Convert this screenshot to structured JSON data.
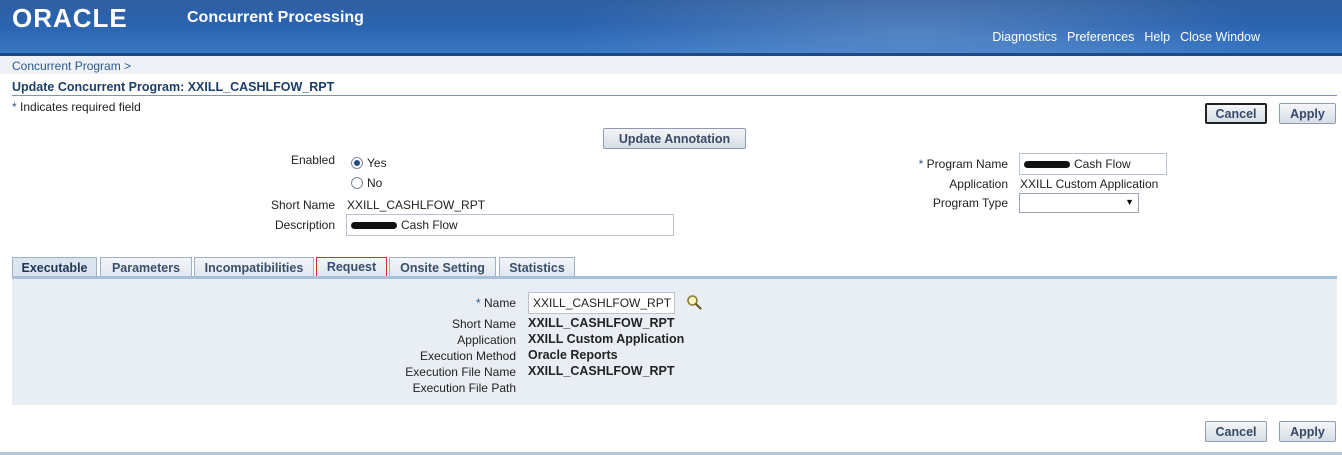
{
  "header": {
    "logo": "ORACLE",
    "app_title": "Concurrent Processing",
    "links": [
      "Diagnostics",
      "Preferences",
      "Help",
      "Close Window"
    ]
  },
  "breadcrumb": "Concurrent Program  >",
  "page_title": "Update Concurrent Program: XXILL_CASHLFOW_RPT",
  "required_note": {
    "star": "*",
    "text": " Indicates required field"
  },
  "buttons": {
    "cancel": "Cancel",
    "apply": "Apply",
    "update_annotation": "Update Annotation"
  },
  "form": {
    "enabled_label": "Enabled",
    "enabled_yes": "Yes",
    "enabled_no": "No",
    "enabled_value": "Yes",
    "short_name_label": "Short Name",
    "short_name_value": "XXILL_CASHLFOW_RPT",
    "description_label": "Description",
    "description_value": "Cash Flow",
    "program_name_label": "Program Name",
    "program_name_value": "Cash Flow",
    "application_label": "Application",
    "application_value": "XXILL Custom Application",
    "program_type_label": "Program Type",
    "program_type_value": ""
  },
  "tabs": [
    {
      "label": "Executable",
      "active": true
    },
    {
      "label": "Parameters"
    },
    {
      "label": "Incompatibilities"
    },
    {
      "label": "Request",
      "highlighted": true
    },
    {
      "label": "Onsite Setting"
    },
    {
      "label": "Statistics"
    }
  ],
  "executable": {
    "name_label": "Name",
    "name_value": "XXILL_CASHLFOW_RPT",
    "short_name_label": "Short Name",
    "short_name_value": "XXILL_CASHLFOW_RPT",
    "application_label": "Application",
    "application_value": "XXILL Custom Application",
    "execution_method_label": "Execution Method",
    "execution_method_value": "Oracle Reports",
    "execution_file_name_label": "Execution File Name",
    "execution_file_name_value": "XXILL_CASHLFOW_RPT",
    "execution_file_path_label": "Execution File Path",
    "execution_file_path_value": ""
  },
  "icons": {
    "search": "magnifier-icon",
    "redaction": "redaction-blot"
  }
}
